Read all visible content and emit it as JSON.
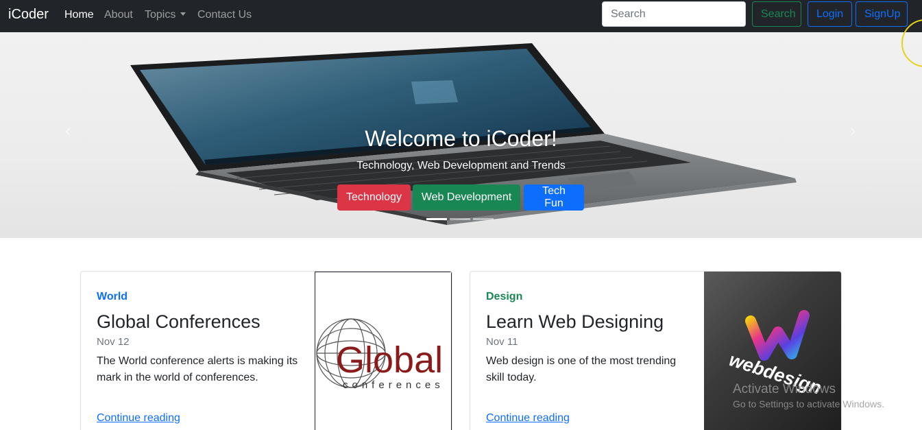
{
  "navbar": {
    "brand": "iCoder",
    "links": [
      {
        "label": "Home",
        "active": true
      },
      {
        "label": "About",
        "active": false
      },
      {
        "label": "Topics",
        "active": false
      },
      {
        "label": "Contact Us",
        "active": false
      }
    ],
    "search_placeholder": "Search",
    "search_button": "Search",
    "login_button": "Login",
    "signup_button": "SignUp"
  },
  "carousel": {
    "title": "Welcome to iCoder!",
    "subtitle": "Technology, Web Development and Trends",
    "buttons": [
      "Technology",
      "Web Development",
      "Tech Fun"
    ],
    "active_slide": 1,
    "slide_count": 3
  },
  "cards": [
    {
      "category": "World",
      "category_color": "#0d6efd",
      "title": "Global Conferences",
      "date": "Nov 12",
      "text": "The World conference alerts is making its mark in the world of conferences.",
      "link": "Continue reading",
      "image_wordmark": "Global",
      "image_tagline": "conferences"
    },
    {
      "category": "Design",
      "category_color": "#198754",
      "title": "Learn Web Designing",
      "date": "Nov 11",
      "text": "Web design is one of the most trending skill today.",
      "link": "Continue reading",
      "image_wordmark": "webdesign"
    }
  ],
  "overlay": {
    "activate_title": "Activate Windows",
    "activate_sub": "Go to Settings to activate Windows."
  },
  "colors": {
    "navbar_bg": "#212529",
    "danger": "#dc3545",
    "success": "#198754",
    "primary": "#0d6efd"
  }
}
